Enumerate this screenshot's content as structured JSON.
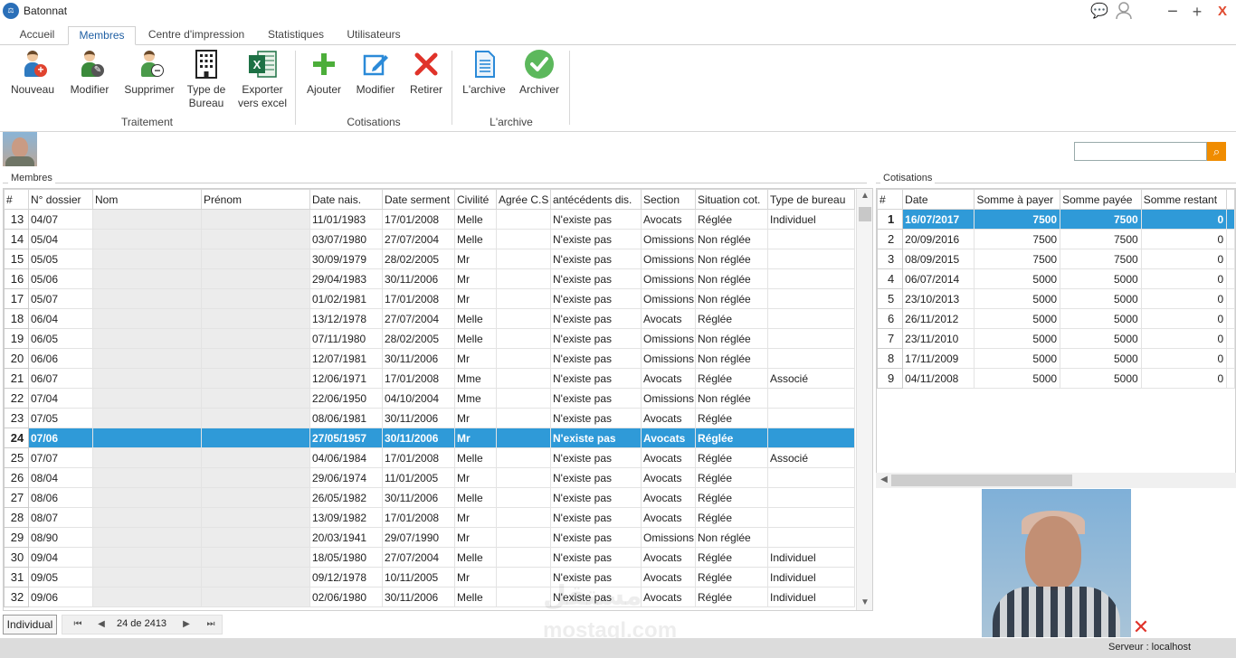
{
  "app": {
    "title": "Batonnat"
  },
  "tabs": [
    "Accueil",
    "Membres",
    "Centre d'impression",
    "Statistiques",
    "Utilisateurs"
  ],
  "ribbon": {
    "traitement": {
      "label": "Traitement",
      "buttons": [
        "Nouveau",
        "Modifier",
        "Supprimer",
        "Type de Bureau",
        "Exporter vers excel"
      ]
    },
    "cotisations": {
      "label": "Cotisations",
      "buttons": [
        "Ajouter",
        "Modifier",
        "Retirer"
      ]
    },
    "archive": {
      "label": "L'archive",
      "buttons": [
        "L'archive",
        "Archiver"
      ]
    }
  },
  "members": {
    "label": "Membres",
    "columns": [
      "#",
      "N° dossier",
      "Nom",
      "Prénom",
      "Date nais.",
      "Date serment",
      "Civilité",
      "Agrée C.S",
      "antécédents dis.",
      "Section",
      "Situation cot.",
      "Type de bureau"
    ],
    "rows": [
      [
        "13",
        "04/07",
        "",
        "",
        "11/01/1983",
        "17/01/2008",
        "Melle",
        "",
        "N'existe pas",
        "Avocats",
        "Réglée",
        "Individuel"
      ],
      [
        "14",
        "05/04",
        "",
        "",
        "03/07/1980",
        "27/07/2004",
        "Melle",
        "",
        "N'existe pas",
        "Omissions",
        "Non réglée",
        ""
      ],
      [
        "15",
        "05/05",
        "",
        "",
        "30/09/1979",
        "28/02/2005",
        "Mr",
        "",
        "N'existe pas",
        "Omissions",
        "Non réglée",
        ""
      ],
      [
        "16",
        "05/06",
        "",
        "",
        "29/04/1983",
        "30/11/2006",
        "Mr",
        "",
        "N'existe pas",
        "Omissions",
        "Non réglée",
        ""
      ],
      [
        "17",
        "05/07",
        "",
        "",
        "01/02/1981",
        "17/01/2008",
        "Mr",
        "",
        "N'existe pas",
        "Omissions",
        "Non réglée",
        ""
      ],
      [
        "18",
        "06/04",
        "",
        "",
        "13/12/1978",
        "27/07/2004",
        "Melle",
        "",
        "N'existe pas",
        "Avocats",
        "Réglée",
        ""
      ],
      [
        "19",
        "06/05",
        "",
        "",
        "07/11/1980",
        "28/02/2005",
        "Melle",
        "",
        "N'existe pas",
        "Omissions",
        "Non réglée",
        ""
      ],
      [
        "20",
        "06/06",
        "",
        "",
        "12/07/1981",
        "30/11/2006",
        "Mr",
        "",
        "N'existe pas",
        "Omissions",
        "Non réglée",
        ""
      ],
      [
        "21",
        "06/07",
        "",
        "",
        "12/06/1971",
        "17/01/2008",
        "Mme",
        "",
        "N'existe pas",
        "Avocats",
        "Réglée",
        "Associé"
      ],
      [
        "22",
        "07/04",
        "",
        "",
        "22/06/1950",
        "04/10/2004",
        "Mme",
        "",
        "N'existe pas",
        "Omissions",
        "Non réglée",
        ""
      ],
      [
        "23",
        "07/05",
        "",
        "",
        "08/06/1981",
        "30/11/2006",
        "Mr",
        "",
        "N'existe pas",
        "Avocats",
        "Réglée",
        ""
      ],
      [
        "24",
        "07/06",
        "",
        "",
        "27/05/1957",
        "30/11/2006",
        "Mr",
        "",
        "N'existe pas",
        "Avocats",
        "Réglée",
        ""
      ],
      [
        "25",
        "07/07",
        "",
        "",
        "04/06/1984",
        "17/01/2008",
        "Melle",
        "",
        "N'existe pas",
        "Avocats",
        "Réglée",
        "Associé"
      ],
      [
        "26",
        "08/04",
        "",
        "",
        "29/06/1974",
        "11/01/2005",
        "Mr",
        "",
        "N'existe pas",
        "Avocats",
        "Réglée",
        ""
      ],
      [
        "27",
        "08/06",
        "",
        "",
        "26/05/1982",
        "30/11/2006",
        "Melle",
        "",
        "N'existe pas",
        "Avocats",
        "Réglée",
        ""
      ],
      [
        "28",
        "08/07",
        "",
        "",
        "13/09/1982",
        "17/01/2008",
        "Mr",
        "",
        "N'existe pas",
        "Avocats",
        "Réglée",
        ""
      ],
      [
        "29",
        "08/90",
        "",
        "",
        "20/03/1941",
        "29/07/1990",
        "Mr",
        "",
        "N'existe pas",
        "Omissions",
        "Non réglée",
        ""
      ],
      [
        "30",
        "09/04",
        "",
        "",
        "18/05/1980",
        "27/07/2004",
        "Melle",
        "",
        "N'existe pas",
        "Avocats",
        "Réglée",
        "Individuel"
      ],
      [
        "31",
        " 09/05",
        "",
        "",
        "09/12/1978",
        "10/11/2005",
        "Mr",
        "",
        "N'existe pas",
        "Avocats",
        "Réglée",
        "Individuel"
      ],
      [
        "32",
        "09/06",
        "",
        "",
        "02/06/1980",
        "30/11/2006",
        "Melle",
        "",
        "N'existe pas",
        "Avocats",
        "Réglée",
        "Individuel"
      ]
    ],
    "selected_row": "24"
  },
  "navigator": {
    "filter": "Individual",
    "position": "24 de 2413"
  },
  "cotisations": {
    "label": "Cotisations",
    "columns": [
      "#",
      "Date",
      "Somme à payer",
      "Somme payée",
      "Somme restant"
    ],
    "rows": [
      [
        "1",
        "16/07/2017",
        "7500",
        "7500",
        "0"
      ],
      [
        "2",
        "20/09/2016",
        "7500",
        "7500",
        "0"
      ],
      [
        "3",
        "08/09/2015",
        "7500",
        "7500",
        "0"
      ],
      [
        "4",
        "06/07/2014",
        "5000",
        "5000",
        "0"
      ],
      [
        "5",
        "23/10/2013",
        "5000",
        "5000",
        "0"
      ],
      [
        "6",
        "26/11/2012",
        "5000",
        "5000",
        "0"
      ],
      [
        "7",
        "23/11/2010",
        "5000",
        "5000",
        "0"
      ],
      [
        "8",
        "17/11/2009",
        "5000",
        "5000",
        "0"
      ],
      [
        "9",
        "04/11/2008",
        "5000",
        "5000",
        "0"
      ]
    ],
    "selected_row": "1"
  },
  "status": {
    "server": "Serveur : localhost"
  },
  "watermark": {
    "line1": "مستقل",
    "line2": "mostaql.com"
  },
  "colors": {
    "selection": "#2f9ad8",
    "accent_blue": "#1f5fa3",
    "search_orange": "#f08c00",
    "close_red": "#e04a2f"
  },
  "icons": {
    "titlebar": [
      "chat-icon",
      "user-icon",
      "minimize-icon",
      "maximize-icon",
      "close-icon"
    ],
    "ribbon": [
      "add-person-icon",
      "edit-person-icon",
      "remove-person-icon",
      "building-icon",
      "excel-icon",
      "plus-icon",
      "edit-icon",
      "cross-icon",
      "document-icon",
      "check-icon"
    ]
  }
}
